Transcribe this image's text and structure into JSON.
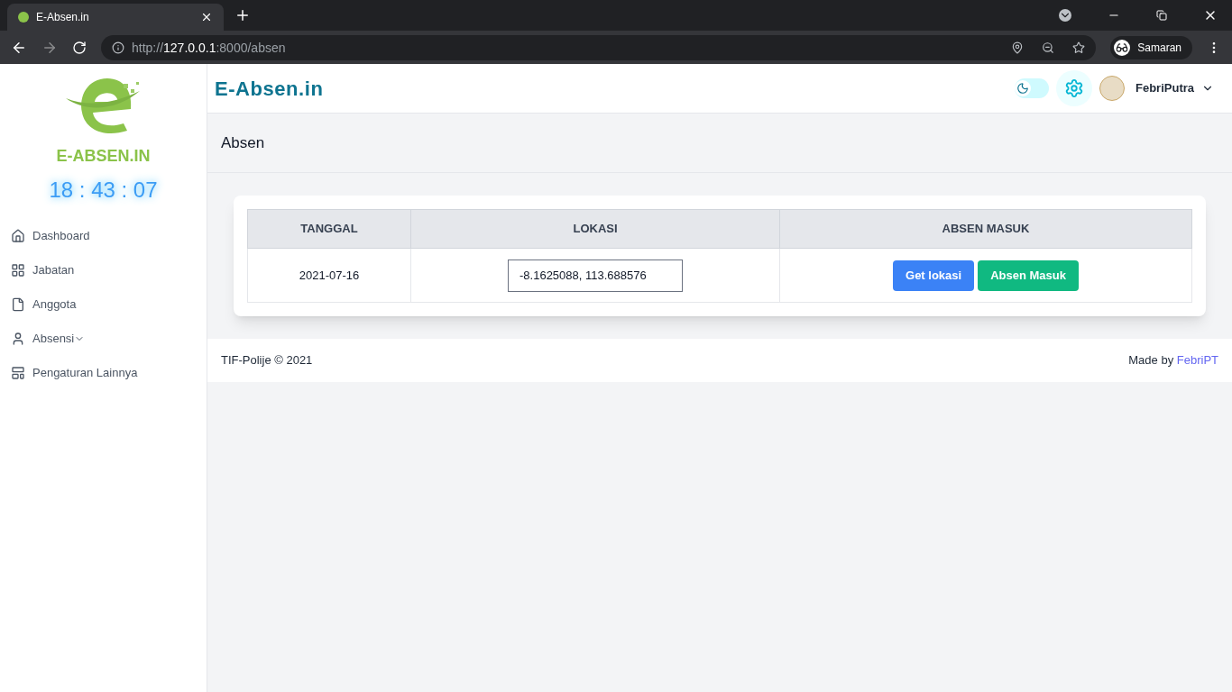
{
  "browser": {
    "tab_title": "E-Absen.in",
    "url": {
      "scheme": "http://",
      "host": "127.0.0.1",
      "path": ":8000/absen"
    },
    "profile": "Samaran"
  },
  "sidebar": {
    "logo_text": "E-ABSEN.IN",
    "clock": "18 : 43 : 07",
    "items": [
      {
        "label": "Dashboard",
        "kind": "home",
        "expandable": false
      },
      {
        "label": "Jabatan",
        "kind": "grid",
        "expandable": false
      },
      {
        "label": "Anggota",
        "kind": "file",
        "expandable": false
      },
      {
        "label": "Absensi",
        "kind": "user",
        "expandable": true
      },
      {
        "label": "Pengaturan Lainnya",
        "kind": "layout",
        "expandable": false
      }
    ]
  },
  "header": {
    "brand": "E-Absen.in",
    "dark_mode": {
      "on": false
    },
    "user": "FebriPutra"
  },
  "page_title": "Absen",
  "table": {
    "columns": [
      "TANGGAL",
      "LOKASI",
      "ABSEN MASUK"
    ],
    "rows": [
      {
        "date": "2021-07-16",
        "location": "-8.1625088, 113.688576",
        "buttons": [
          {
            "label": "Get lokasi",
            "kind": "primary"
          },
          {
            "label": "Absen Masuk",
            "kind": "success"
          }
        ]
      }
    ]
  },
  "footer": {
    "left": "TIF-Polije © 2021",
    "made_by": "Made by",
    "author": "FebriPT"
  }
}
